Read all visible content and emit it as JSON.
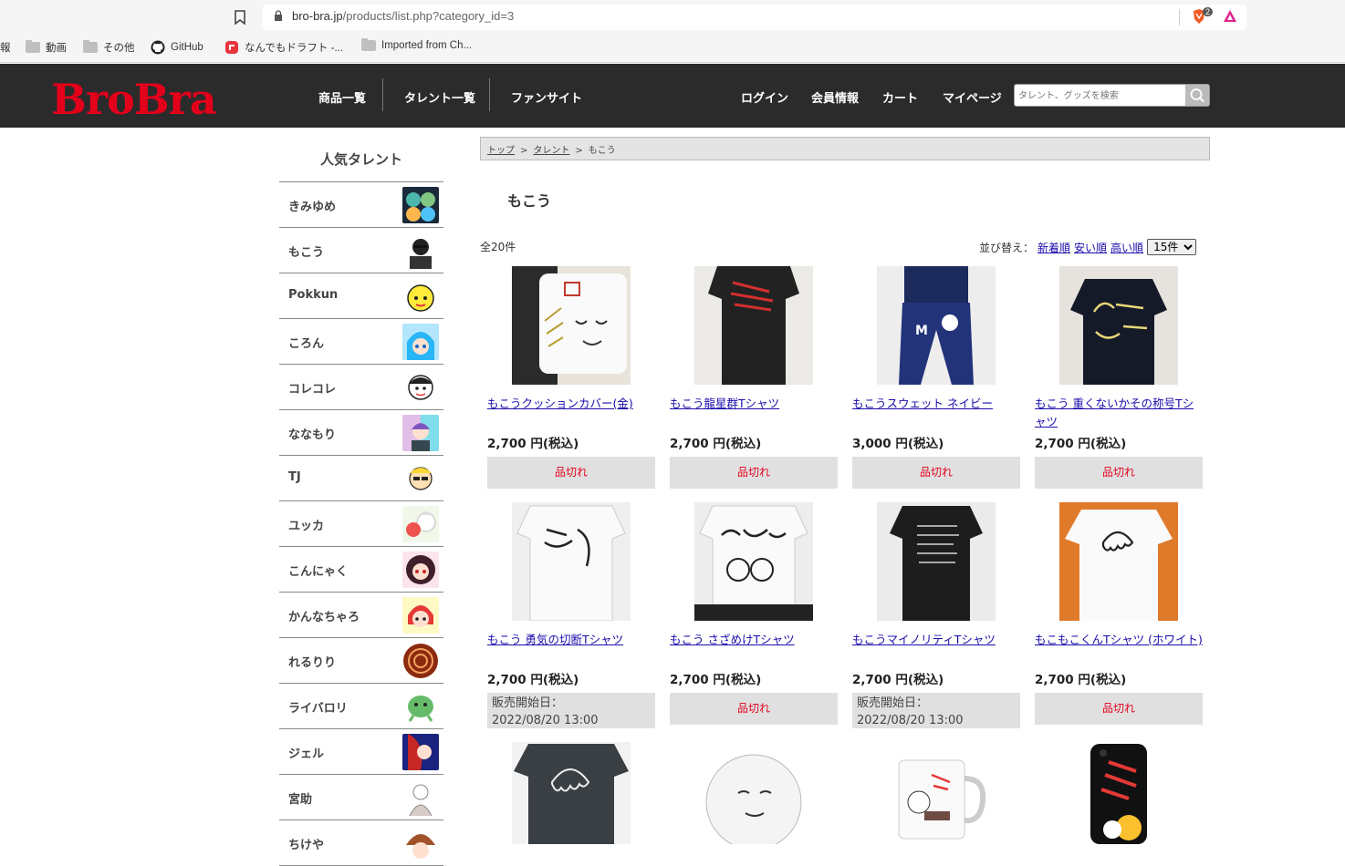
{
  "browser": {
    "url_host": "bro-bra.jp",
    "url_path": "/products/list.php?category_id=3",
    "extension_badge": "2",
    "bookmarks": [
      "報",
      "動画",
      "その他",
      "GitHub",
      "なんでもドラフト -...",
      "Imported from Ch..."
    ]
  },
  "header": {
    "logo": "BroBra",
    "nav_left": [
      "商品一覧",
      "タレント一覧",
      "ファンサイト"
    ],
    "nav_right": [
      "ログイン",
      "会員情報",
      "カート",
      "マイページ"
    ],
    "search_placeholder": "タレント、グッズを検索"
  },
  "sidebar": {
    "title": "人気タレント",
    "talents": [
      "きみゆめ",
      "もこう",
      "Pokkun",
      "ころん",
      "コレコレ",
      "ななもり",
      "TJ",
      "ユッカ",
      "こんにゃく",
      "かんなちゃろ",
      "れるりり",
      "ライバロリ",
      "ジェル",
      "宮助",
      "ちけや"
    ]
  },
  "breadcrumb": {
    "top": "トップ",
    "talent": "タレント",
    "current": "もこう",
    "sep": ">"
  },
  "main": {
    "title": "もこう",
    "count": "全20件",
    "sort_label": "並び替え：",
    "sort_options": [
      "新着順",
      "安い順",
      "高い順"
    ],
    "per_page": "15件"
  },
  "products": [
    {
      "name": "もこうクッションカバー(金)",
      "price": "2,700 円(税込)",
      "status": "品切れ"
    },
    {
      "name": "もこう龍星群Tシャツ",
      "price": "2,700 円(税込)",
      "status": "品切れ"
    },
    {
      "name": "もこうスウェット ネイビー",
      "price": "3,000 円(税込)",
      "status": "品切れ"
    },
    {
      "name": "もこう 重くないかその称号Tシャツ",
      "price": "2,700 円(税込)",
      "status": "品切れ"
    },
    {
      "name": "もこう 勇気の切断Tシャツ",
      "price": "2,700 円(税込)",
      "release_label": "販売開始日：",
      "release_date": "2022/08/20 13:00"
    },
    {
      "name": "もこう さざめけTシャツ",
      "price": "2,700 円(税込)",
      "status": "品切れ"
    },
    {
      "name": "もこうマイノリティTシャツ",
      "price": "2,700 円(税込)",
      "release_label": "販売開始日：",
      "release_date": "2022/08/20 13:00"
    },
    {
      "name": "もこもこくんTシャツ (ホワイト)",
      "price": "2,700 円(税込)",
      "status": "品切れ"
    }
  ],
  "colors": {
    "brand_red": "#e3001b",
    "header_bg": "#2b2b2b",
    "link": "#1a0dab"
  }
}
